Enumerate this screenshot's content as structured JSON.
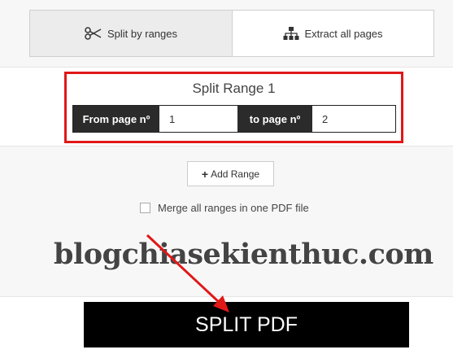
{
  "tabs": [
    {
      "label": "Split by ranges",
      "icon": "scissors-icon",
      "active": true
    },
    {
      "label": "Extract all pages",
      "icon": "sitemap-icon",
      "active": false
    }
  ],
  "range": {
    "title": "Split Range 1",
    "from_label": "From page nº",
    "from_value": "1",
    "to_label": "to page nº",
    "to_value": "2"
  },
  "add_range_label": "Add Range",
  "merge_label": "Merge all ranges in one PDF file",
  "watermark": "blogchiasekienthuc.com",
  "split_button_label": "SPLIT PDF",
  "colors": {
    "highlight": "#e01818",
    "button_bg": "#000000",
    "label_bg": "#2b2b2b"
  }
}
